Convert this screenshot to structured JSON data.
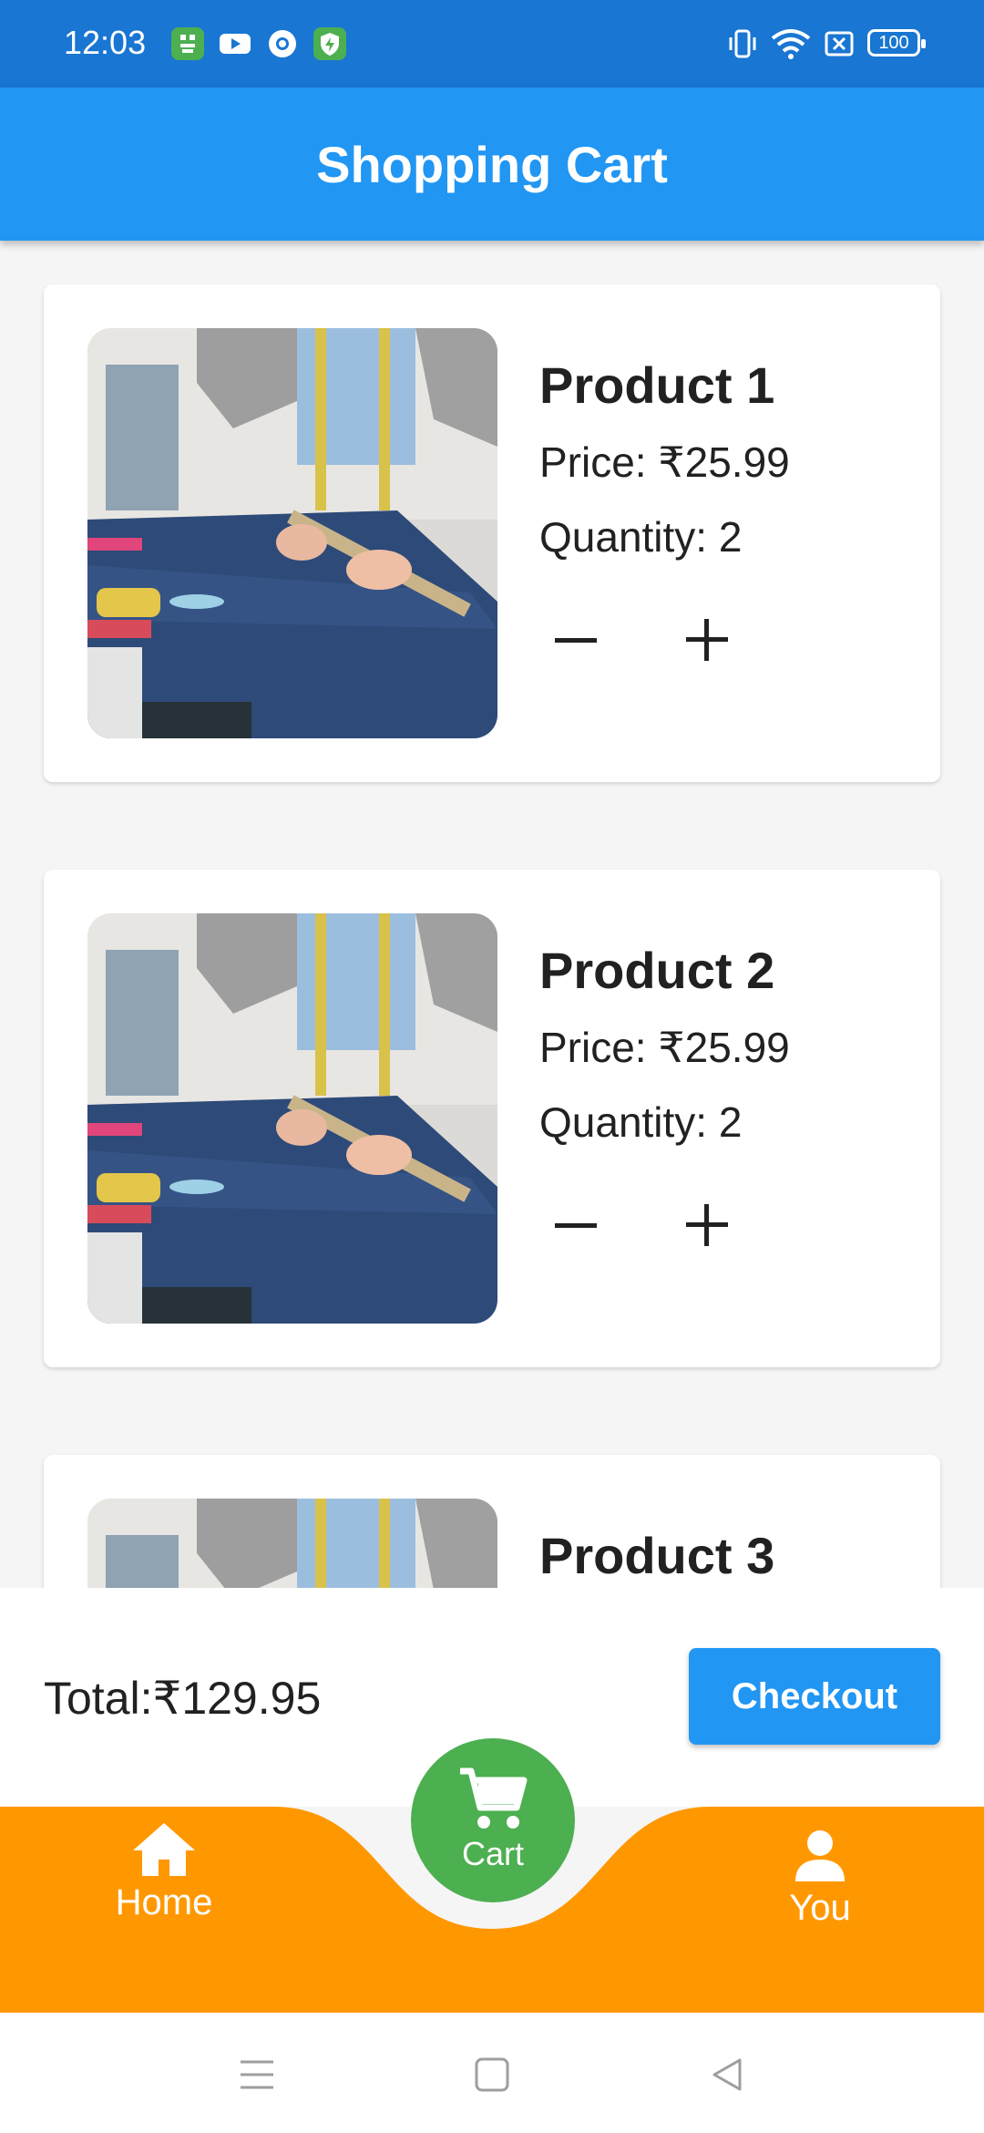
{
  "status_bar": {
    "time": "12:03",
    "battery": "100",
    "left_icons": [
      "tiktok-icon",
      "youtube-icon",
      "chrome-icon",
      "security-icon"
    ],
    "right_icons": [
      "vibrate-icon",
      "wifi-icon",
      "no-sim-icon",
      "battery-icon"
    ]
  },
  "app_bar": {
    "title": "Shopping Cart"
  },
  "products": [
    {
      "name": "Product 1",
      "price": "Price: ₹25.99",
      "quantity": "Quantity: 2"
    },
    {
      "name": "Product 2",
      "price": "Price: ₹25.99",
      "quantity": "Quantity: 2"
    },
    {
      "name": "Product 3"
    }
  ],
  "cart_summary": {
    "total": "Total:₹129.95",
    "checkout_label": "Checkout"
  },
  "bottom_nav": {
    "home": {
      "label": "Home",
      "icon": "home-icon"
    },
    "cart": {
      "label": "Cart",
      "icon": "cart-icon"
    },
    "you": {
      "label": "You",
      "icon": "person-icon"
    }
  },
  "colors": {
    "status_bar": "#1976d2",
    "app_bar": "#2196f3",
    "bottom_nav": "#ff9800",
    "cart_fab": "#4caf50",
    "checkout": "#2196f3"
  }
}
